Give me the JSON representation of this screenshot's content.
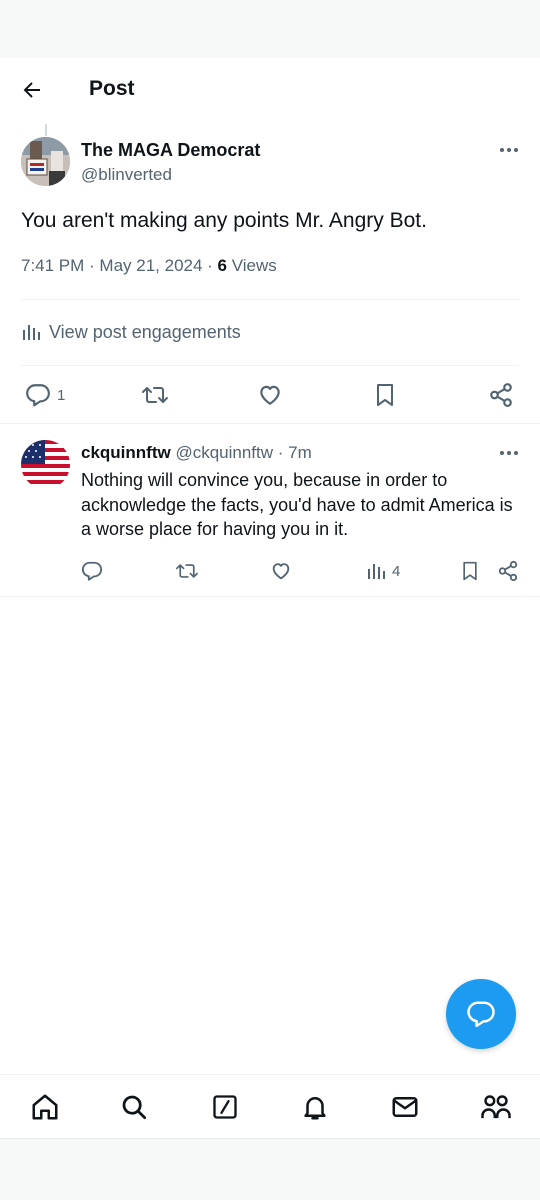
{
  "header": {
    "title": "Post",
    "back_icon": "arrow-left-icon"
  },
  "post": {
    "author_name": "The MAGA Democrat",
    "author_handle": "@blinverted",
    "avatar_sign_text": "DRINKING HATED",
    "text": "You aren't making any points Mr. Angry Bot.",
    "time": "7:41 PM",
    "date": "May 21, 2024",
    "meta_separator": " · ",
    "views_count": "6",
    "views_label": " Views",
    "engagements_label": "View post engagements",
    "reply_count": "1"
  },
  "reply": {
    "author_name": "ckquinnftw",
    "author_handle": "@ckquinnftw",
    "time_separator": " · ",
    "time": "7m",
    "text": "Nothing will convince you, because in order to acknowledge the facts, you'd have to admit America is a worse place for having you in it.",
    "views_count": "4",
    "avatar": "american-flag"
  },
  "bottom_nav": {
    "items": [
      "home-icon",
      "search-icon",
      "grok-icon",
      "notifications-icon",
      "messages-icon",
      "communities-icon"
    ]
  },
  "colors": {
    "accent": "#1d9bf0",
    "text_primary": "#0f1419",
    "text_secondary": "#536471",
    "divider": "#eff3f4"
  }
}
